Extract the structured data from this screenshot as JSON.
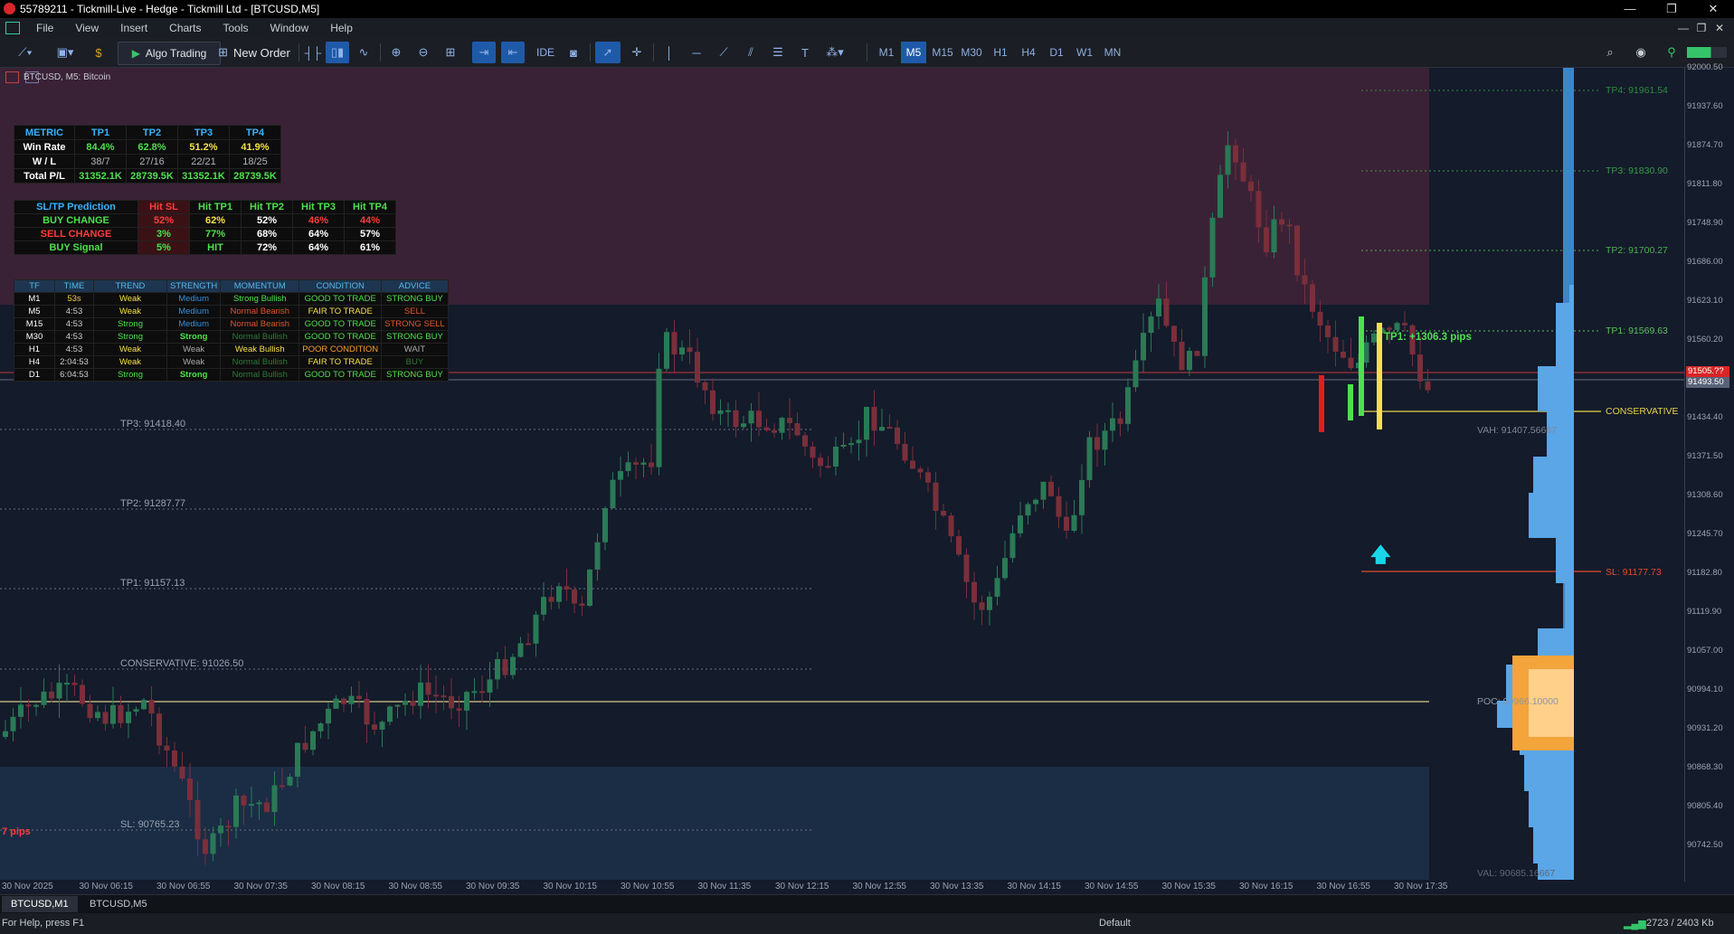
{
  "window": {
    "title": "55789211 - Tickmill-Live - Hedge - Tickmill Ltd - [BTCUSD,M5]",
    "min": "—",
    "restore": "❐",
    "close": "✕"
  },
  "menu": [
    "File",
    "View",
    "Insert",
    "Charts",
    "Tools",
    "Window",
    "Help"
  ],
  "toolbar": {
    "algo_trading": "Algo Trading",
    "new_order": "New Order",
    "ide": "IDE",
    "timeframes": [
      "M1",
      "M5",
      "M15",
      "M30",
      "H1",
      "H4",
      "D1",
      "W1",
      "MN"
    ],
    "active_timeframe": "M5"
  },
  "chart": {
    "symbol_label": "BTCUSD, M5:  Bitcoin"
  },
  "metric_table": {
    "headers": [
      "METRIC",
      "TP1",
      "TP2",
      "TP3",
      "TP4"
    ],
    "rows": [
      [
        "Win Rate",
        "84.4%",
        "62.8%",
        "51.2%",
        "41.9%"
      ],
      [
        "W / L",
        "38/7",
        "27/16",
        "22/21",
        "18/25"
      ],
      [
        "Total P/L",
        "31352.1K",
        "28739.5K",
        "31352.1K",
        "28739.5K"
      ]
    ]
  },
  "prediction_table": {
    "headers": [
      "SL/TP Prediction",
      "Hit SL",
      "Hit TP1",
      "Hit TP2",
      "Hit TP3",
      "Hit TP4"
    ],
    "rows": [
      [
        "BUY CHANGE",
        "52%",
        "62%",
        "52%",
        "46%",
        "44%"
      ],
      [
        "SELL CHANGE",
        "3%",
        "77%",
        "68%",
        "64%",
        "57%"
      ],
      [
        "BUY Signal",
        "5%",
        "HIT",
        "72%",
        "64%",
        "61%"
      ]
    ]
  },
  "tf_table": {
    "headers": [
      "TF",
      "TIME",
      "TREND",
      "STRENGTH",
      "MOMENTUM",
      "CONDITION",
      "ADVICE"
    ],
    "rows": [
      [
        "M1",
        "53s",
        "Weak",
        "Medium",
        "Strong Bullish",
        "GOOD TO TRADE",
        "STRONG BUY"
      ],
      [
        "M5",
        "4:53",
        "Weak",
        "Medium",
        "Normal Bearish",
        "FAIR TO TRADE",
        "SELL"
      ],
      [
        "M15",
        "4:53",
        "Strong",
        "Medium",
        "Normal Bearish",
        "GOOD TO TRADE",
        "STRONG SELL"
      ],
      [
        "M30",
        "4:53",
        "Strong",
        "Strong",
        "Normal Bullish",
        "GOOD TO TRADE",
        "STRONG BUY"
      ],
      [
        "H1",
        "4:53",
        "Weak",
        "Weak",
        "Weak Bullish",
        "POOR CONDITION",
        "WAIT"
      ],
      [
        "H4",
        "2:04:53",
        "Weak",
        "Weak",
        "Normal Bullish",
        "FAIR TO TRADE",
        "BUY"
      ],
      [
        "D1",
        "6:04:53",
        "Strong",
        "Strong",
        "Normal Bullish",
        "GOOD TO TRADE",
        "STRONG BUY"
      ]
    ]
  },
  "left_levels": {
    "tp3": "TP3: 91418.40",
    "tp2": "TP2: 91287.77",
    "tp1": "TP1: 91157.13",
    "conservative": "CONSERVATIVE: 91026.50",
    "sl": "SL: 90765.23",
    "pips": "7 pips"
  },
  "right_levels": {
    "tp4": "TP4: 91961.54",
    "tp3": "TP3: 91830.90",
    "tp2": "TP2: 91700.27",
    "tp1": "TP1: 91569.63",
    "conservative": "CONSERVATIVE",
    "sl": "SL: 91177.73",
    "tp1_pips": "TP1: +1306.3 pips"
  },
  "volume_profile": {
    "vah": "VAH: 91407.56667",
    "poc": "POC: 90966.10000",
    "val": "VAL: 90685.16667"
  },
  "price_axis": {
    "ticks": [
      "92000.50",
      "91937.60",
      "91874.70",
      "91811.80",
      "91748.90",
      "91686.00",
      "91623.10",
      "91560.20",
      "91497.30",
      "91434.40",
      "91371.50",
      "91308.60",
      "91245.70",
      "91182.80",
      "91119.90",
      "91057.00",
      "90994.10",
      "90931.20",
      "90868.30",
      "90805.40",
      "90742.50"
    ],
    "ask": "91505.??",
    "bid": "91493.50"
  },
  "time_axis": [
    "30 Nov 2025",
    "30 Nov 06:15",
    "30 Nov 06:55",
    "30 Nov 07:35",
    "30 Nov 08:15",
    "30 Nov 08:55",
    "30 Nov 09:35",
    "30 Nov 10:15",
    "30 Nov 10:55",
    "30 Nov 11:35",
    "30 Nov 12:15",
    "30 Nov 12:55",
    "30 Nov 13:35",
    "30 Nov 14:15",
    "30 Nov 14:55",
    "30 Nov 15:35",
    "30 Nov 16:15",
    "30 Nov 16:55",
    "30 Nov 17:35"
  ],
  "tabs": [
    "BTCUSD,M1",
    "BTCUSD,M5"
  ],
  "status": {
    "help": "For Help, press F1",
    "profile": "Default",
    "traffic": "2723 / 2403 Kb"
  },
  "colors": {
    "bull": "#2a7a55",
    "bear": "#7a2f3a",
    "tp": "#4caf50",
    "sl": "#e04b2a",
    "conservative": "#e8d24a"
  }
}
